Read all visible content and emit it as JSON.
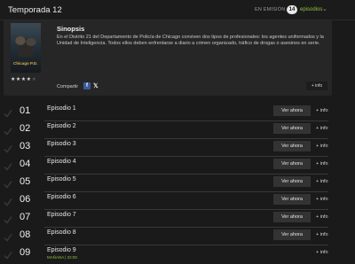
{
  "header": {
    "title": "Temporada 12",
    "status": "EN EMISIÓN",
    "count": "14",
    "episodes_label": "episodios"
  },
  "synopsis": {
    "poster_logo_main": "Chicago",
    "poster_logo_suffix": "P.D.",
    "rating_stars": 3.5,
    "heading": "Sinopsis",
    "text": "En el Distrito 21 del Departamento de Policía de Chicago conviven dos tipos de profesionales: los agentes uniformados y la Unidad de Inteligencia. Todos ellos deben enfrentarse a diario a crimen organizado, tráfico de drogas o asesinos en serie.",
    "share_label": "Compartir",
    "facebook_glyph": "f",
    "x_glyph": "𝕏",
    "more_info": "+ info"
  },
  "episodes": [
    {
      "num": "01",
      "name": "Episodio 1",
      "watch": "Ver ahora",
      "info": "+ info"
    },
    {
      "num": "02",
      "name": "Episodio 2",
      "watch": "Ver ahora",
      "info": "+ info"
    },
    {
      "num": "03",
      "name": "Episodio 3",
      "watch": "Ver ahora",
      "info": "+ info"
    },
    {
      "num": "04",
      "name": "Episodio 4",
      "watch": "Ver ahora",
      "info": "+ info"
    },
    {
      "num": "05",
      "name": "Episodio 5",
      "watch": "Ver ahora",
      "info": "+ info"
    },
    {
      "num": "06",
      "name": "Episodio 6",
      "watch": "Ver ahora",
      "info": "+ info"
    },
    {
      "num": "07",
      "name": "Episodio 7",
      "watch": "Ver ahora",
      "info": "+ info"
    },
    {
      "num": "08",
      "name": "Episodio 8",
      "watch": "Ver ahora",
      "info": "+ info"
    },
    {
      "num": "09",
      "name": "Episodio 9",
      "date": "MAÑANA | 22:00",
      "info": "+ info"
    }
  ],
  "colors": {
    "accent": "#8dc63f",
    "background": "#1a1a1a",
    "button": "#333333"
  }
}
